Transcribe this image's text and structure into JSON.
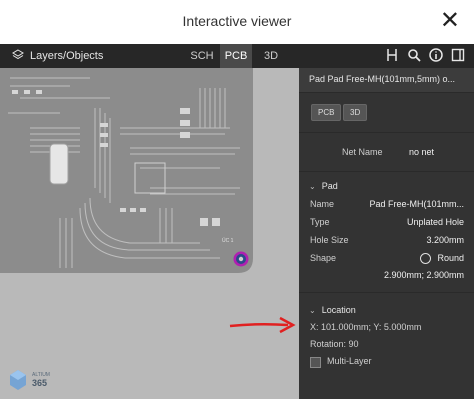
{
  "window": {
    "title": "Interactive viewer",
    "close_label": "✕"
  },
  "toolbar": {
    "layers_label": "Layers/Objects",
    "tabs": [
      {
        "label": "SCH"
      },
      {
        "label": "PCB"
      },
      {
        "label": "3D"
      }
    ],
    "active_tab": "PCB"
  },
  "panel": {
    "header": "Pad Pad Free-MH(101mm,5mm) o...",
    "view_buttons": [
      "PCB",
      "3D"
    ],
    "net_name_label": "Net Name",
    "net_name_value": "no net",
    "pad_section": "Pad",
    "name_label": "Name",
    "name_value": "Pad Free-MH(101mm...",
    "type_label": "Type",
    "type_value": "Unplated Hole",
    "hole_size_label": "Hole Size",
    "hole_size_value": "3.200mm",
    "shape_label": "Shape",
    "shape_value": "Round",
    "shape_size": "2.900mm; 2.900mm",
    "location_section": "Location",
    "location_value": "X: 101.000mm; Y: 5.000mm",
    "rotation": "Rotation: 90",
    "multi_layer": "Multi-Layer"
  },
  "board": {
    "silk_label": "ÜC 1"
  },
  "logo": {
    "line1": "ALTIUM",
    "line2": "365"
  },
  "colors": {
    "accent": "#e02020",
    "pad_ring": "#b01fb0",
    "panel_bg": "#333333",
    "board": "#8a8a8a"
  }
}
